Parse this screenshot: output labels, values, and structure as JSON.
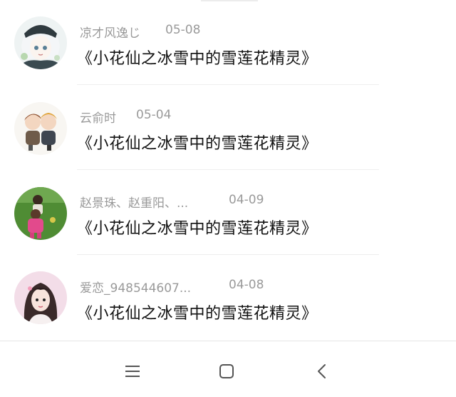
{
  "conversations": [
    {
      "name": "凉才风逸じ",
      "date": "05-08",
      "title": "《小花仙之冰雪中的雪莲花精灵》",
      "avatar": {
        "icon": "anime-girl-avatar",
        "bg": "#e8eef0",
        "accent": "#2f3a3f"
      }
    },
    {
      "name": "云俞时",
      "date": "05-04",
      "title": "《小花仙之冰雪中的雪莲花精灵》",
      "avatar": {
        "icon": "couple-cartoon-avatar",
        "bg": "#f7f4f0",
        "accent": "#a0643a"
      }
    },
    {
      "name": "赵景珠、赵重阳、...",
      "date": "04-09",
      "title": "《小花仙之冰雪中的雪莲花精灵》",
      "avatar": {
        "icon": "children-photo-avatar",
        "bg": "#4c8a32",
        "accent": "#e24a8c"
      }
    },
    {
      "name": "爱恋_948544607...",
      "date": "04-08",
      "title": "《小花仙之冰雪中的雪莲花精灵》",
      "avatar": {
        "icon": "girl-photo-avatar",
        "bg": "#f1d9e6",
        "accent": "#3a2a2a"
      }
    }
  ],
  "navigation": {
    "menu_icon": "menu-icon",
    "home_icon": "home-square-icon",
    "back_icon": "back-chevron-icon",
    "icon_color": "#555555"
  }
}
